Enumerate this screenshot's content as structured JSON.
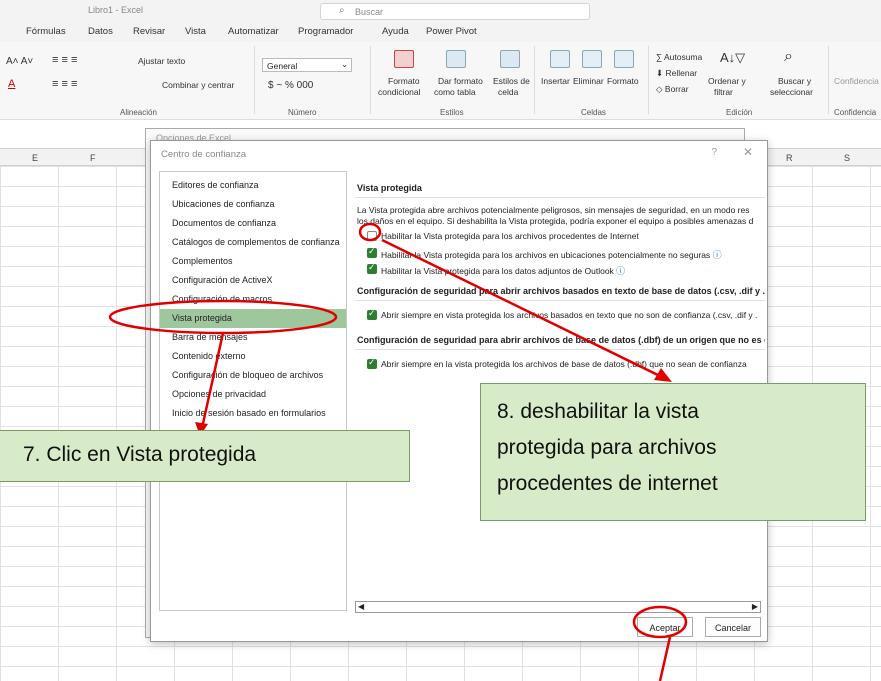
{
  "titlebar": {
    "doc_title": "Libro1 - Excel",
    "search_placeholder": "Buscar"
  },
  "menu_tabs": [
    "Fórmulas",
    "Datos",
    "Revisar",
    "Vista",
    "Automatizar",
    "Programador",
    "Ayuda",
    "Power Pivot"
  ],
  "ribbon": {
    "ajustar": "Ajustar texto",
    "combinar": "Combinar y centrar",
    "number_format": "General",
    "currency": "$ ~ % 000",
    "formato_cond_1": "Formato",
    "formato_cond_2": "condicional",
    "dar_formato_1": "Dar formato",
    "dar_formato_2": "como tabla",
    "estilos_1": "Estilos de",
    "estilos_2": "celda",
    "insertar": "Insertar",
    "eliminar": "Eliminar",
    "formato": "Formato",
    "autosuma": "Autosuma",
    "rellenar": "Rellenar",
    "borrar": "Borrar",
    "ordenar_1": "Ordenar y",
    "ordenar_2": "filtrar",
    "buscar_1": "Buscar y",
    "buscar_2": "seleccionar",
    "confidencial": "Confidencia",
    "groups": {
      "alineacion": "Alineación",
      "numero": "Número",
      "estilos": "Estilos",
      "celdas": "Celdas",
      "edicion": "Edición",
      "confidencialidad": "Confidencia"
    }
  },
  "columns": [
    "E",
    "F",
    "R",
    "S"
  ],
  "bg_dialog_title": "Opciones de Excel",
  "dialog": {
    "title": "Centro de confianza",
    "help": "?",
    "close": "✕",
    "nav_items": [
      "Editores de confianza",
      "Ubicaciones de confianza",
      "Documentos de confianza",
      "Catálogos de complementos de confianza",
      "Complementos",
      "Configuración de ActiveX",
      "Configuración de macros",
      "Vista protegida",
      "Barra de mensajes",
      "Contenido externo",
      "Configuración de bloqueo de archivos",
      "Opciones de privacidad",
      "Inicio de sesión basado en formularios"
    ],
    "section_title": "Vista protegida",
    "desc_line1": "La Vista protegida abre archivos potencialmente peligrosos, sin mensajes de seguridad, en un modo res",
    "desc_line2": "los daños en el equipo. Si deshabilita la Vista protegida, podría exponer el equipo a posibles amenazas d",
    "options": [
      {
        "label": "Habilitar la Vista protegida para los archivos procedentes de Internet",
        "checked": false
      },
      {
        "label": "Habilitar la Vista protegida para los archivos en ubicaciones potencialmente no seguras",
        "checked": true
      },
      {
        "label": "Habilitar la Vista protegida para los datos adjuntos de Outlook",
        "checked": true
      }
    ],
    "section2": "Configuración de seguridad para abrir archivos basados en texto de base de datos (.csv, .dif y .sylk) de",
    "option2": "Abrir siempre en vista protegida los archivos basados en texto que no son de confianza (.csv, .dif y .",
    "section3": "Configuración de seguridad para abrir archivos de base de datos (.dbf) de un origen que no es de con",
    "option3": "Abrir siempre en la vista protegida los archivos de base de datos (.dbf) que no sean de confianza",
    "ok": "Aceptar",
    "cancel": "Cancelar"
  },
  "callouts": {
    "step7": "7.   Clic en Vista protegida",
    "step8_l1": "8. deshabilitar la vista",
    "step8_l2": "protegida para archivos",
    "step8_l3": "procedentes de internet"
  },
  "colors": {
    "annotation": "#e00000",
    "callout_bg": "#d8ebc8",
    "selected_nav": "#9ec79e",
    "checkbox": "#2e7d32"
  }
}
